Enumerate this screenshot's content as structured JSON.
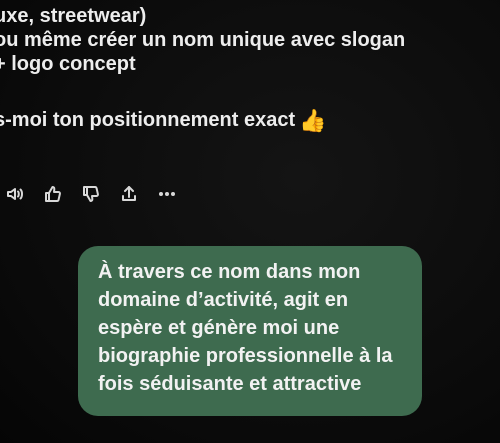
{
  "assistant_message": {
    "lines": [
      "uxe, streetwear)",
      "ou même créer un nom unique avec slogan",
      "+ logo concept",
      "s-moi ton positionnement exact"
    ],
    "emoji": "👍"
  },
  "actions": {
    "icons": [
      "speaker-icon",
      "thumbs-up-icon",
      "thumbs-down-icon",
      "share-icon",
      "more-icon"
    ]
  },
  "user_message": {
    "lines": [
      "À travers ce nom dans mon",
      "domaine d’activité, agit en",
      "espère et génère moi une",
      "biographie professionnelle à la",
      "fois séduisante et attractive"
    ]
  },
  "colors": {
    "background": "#0b0b0b",
    "user_bubble": "#3e6b4f",
    "text": "#ededed",
    "emoji": "#f5b431"
  }
}
